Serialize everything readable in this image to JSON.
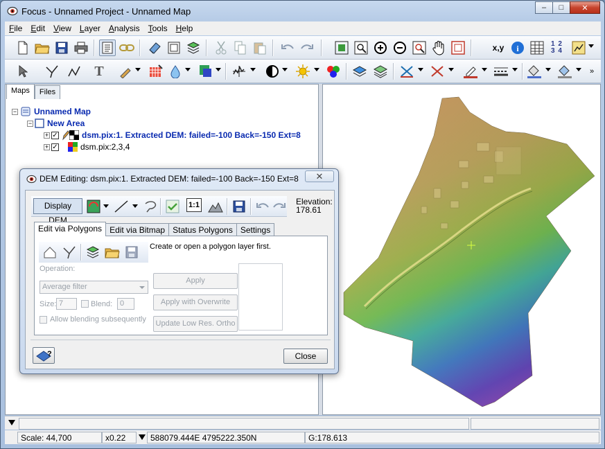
{
  "window": {
    "title": "Focus - Unnamed Project - Unnamed Map",
    "controls": {
      "minimize": "–",
      "maximize": "□",
      "close": "✕"
    }
  },
  "menu": [
    "File",
    "Edit",
    "View",
    "Layer",
    "Analysis",
    "Tools",
    "Help"
  ],
  "toolbar1": {
    "items": [
      "new-file",
      "open-folder",
      "save",
      "print",
      "map-list",
      "link",
      "eraser",
      "page-setup",
      "layers",
      "cut",
      "copy",
      "paste",
      "undo",
      "redo",
      "zoom-extent",
      "zoom-box",
      "zoom-in",
      "zoom-out",
      "zoom-fit",
      "pan-hand",
      "zoom-window",
      "xy-coords",
      "info",
      "table",
      "numbered-list",
      "trace"
    ],
    "xy_label": "x,y",
    "info_label": "i",
    "numbers_label": "1 2 3 4"
  },
  "toolbar2": {
    "text_tool_label": "T"
  },
  "left_panel": {
    "tabs": [
      "Maps",
      "Files"
    ],
    "tree": {
      "root": "Unnamed Map",
      "area": "New Area",
      "layer1": "dsm.pix:1. Extracted DEM: failed=-100 Back=-150 Ext=8",
      "layer2": "dsm.pix:2,3,4"
    }
  },
  "dialog": {
    "title": "DEM Editing: dsm.pix:1. Extracted DEM: failed=-100 Back=-150 Ext=8",
    "close_glyph": "✕",
    "display_dem": "Display DEM",
    "one_to_one": "1:1",
    "elevation_label": "Elevation:",
    "elevation_value": "178.61",
    "tabs": [
      "Edit via Polygons",
      "Edit via Bitmap",
      "Status Polygons",
      "Settings"
    ],
    "hint": "Create or open a polygon layer first.",
    "operation_label": "Operation:",
    "operation_value": "Average filter",
    "size_label": "Size:",
    "size_value": "7",
    "blend_label": "Blend:",
    "blend_value": "0",
    "allow_blending": "Allow blending subsequently",
    "apply": "Apply",
    "apply_overwrite": "Apply with Overwrite",
    "update_ortho": "Update Low Res. Ortho",
    "close": "Close"
  },
  "status": {
    "scale": "Scale: 44,700",
    "zoom": "x0.22",
    "coords": "588079.444E 4795222.350N",
    "value": "G:178.613"
  },
  "colors": {
    "tree_link": "#0a2bb0",
    "dem_high": "#c08a4a",
    "dem_mid": "#7fbf3a",
    "dem_low": "#5a3fc9"
  }
}
